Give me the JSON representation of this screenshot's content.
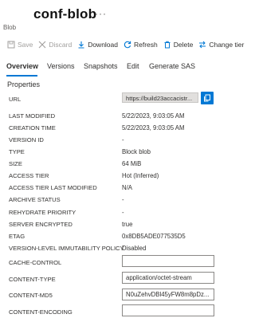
{
  "header": {
    "title": "conf-blob",
    "more": "···",
    "subtitle": "Blob"
  },
  "toolbar": {
    "save": "Save",
    "discard": "Discard",
    "download": "Download",
    "refresh": "Refresh",
    "delete": "Delete",
    "change_tier": "Change tier"
  },
  "tabs": [
    "Overview",
    "Versions",
    "Snapshots",
    "Edit",
    "Generate SAS"
  ],
  "active_tab": "Overview",
  "properties": {
    "heading": "Properties",
    "url_label": "URL",
    "url_value": "https://build23accacistr...",
    "rows": [
      {
        "label": "LAST MODIFIED",
        "value": "5/22/2023, 9:03:05 AM"
      },
      {
        "label": "CREATION TIME",
        "value": "5/22/2023, 9:03:05 AM"
      },
      {
        "label": "VERSION ID",
        "value": "-"
      },
      {
        "label": "TYPE",
        "value": "Block blob"
      },
      {
        "label": "SIZE",
        "value": "64 MiB"
      },
      {
        "label": "ACCESS TIER",
        "value": "Hot (Inferred)"
      },
      {
        "label": "ACCESS TIER LAST MODIFIED",
        "value": "N/A"
      },
      {
        "label": "ARCHIVE STATUS",
        "value": "-"
      },
      {
        "label": "REHYDRATE PRIORITY",
        "value": "-"
      },
      {
        "label": "SERVER ENCRYPTED",
        "value": "true"
      },
      {
        "label": "ETAG",
        "value": "0x8DB5ADE077535D5"
      },
      {
        "label": "VERSION-LEVEL IMMUTABILITY POLICY",
        "value": "Disabled"
      }
    ],
    "cache_control": {
      "label": "CACHE-CONTROL",
      "value": ""
    },
    "content_type": {
      "label": "CONTENT-TYPE",
      "value": "application/octet-stream"
    },
    "content_md5": {
      "label": "CONTENT-MD5",
      "value": "N0uZehvDBl45yFW8m8pDz..."
    },
    "content_encoding": {
      "label": "CONTENT-ENCODING",
      "value": ""
    }
  },
  "colors": {
    "accent": "#0078d4",
    "disabled_text": "#a19f9d",
    "text": "#323130"
  },
  "icons": {
    "save": "save-icon",
    "discard": "close-icon",
    "download": "download-icon",
    "refresh": "refresh-icon",
    "delete": "trash-icon",
    "change_tier": "swap-icon",
    "copy": "copy-icon"
  }
}
